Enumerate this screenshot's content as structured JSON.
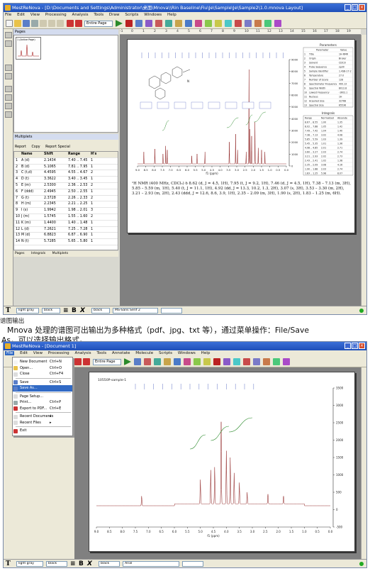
{
  "screenshot1": {
    "title": "MestReNova - [D:\\Documents and Settings\\Administrator\\桌面\\Mnova\\\\Rin Baseline\\Fiu\\Je\\Sample\\Je\\Sample2\\1.0.mnova Layout]",
    "menu": [
      "File",
      "Edit",
      "View",
      "Processing",
      "Analysis",
      "Tools",
      "Draw",
      "Scripts",
      "Windows",
      "Help"
    ],
    "toolbar_combo": "Entire Page",
    "ruler": [
      "-1",
      "0",
      "1",
      "2",
      "3",
      "4",
      "5",
      "6",
      "7",
      "8",
      "9",
      "10",
      "11",
      "12",
      "13",
      "14",
      "15",
      "16",
      "17",
      "18",
      "19",
      "20",
      "21",
      "22",
      "23",
      "24",
      "25",
      "26",
      "27"
    ],
    "pages_header": "Pages",
    "thumb_label": "1 (Active Page)",
    "table_header": "Multiplets",
    "table_tools": [
      "Report",
      "Copy",
      "Report Special"
    ],
    "table_columns": [
      "",
      "Name",
      "Shift",
      "Range",
      "H's"
    ],
    "table_rows": [
      [
        "1",
        "A (d)",
        "2.1434",
        "7.40 .. 7.45",
        "1"
      ],
      [
        "2",
        "B (d)",
        "5.1065",
        "7.81 .. 7.95",
        "1"
      ],
      [
        "3",
        "C (t,d)",
        "4.4595",
        "4.55 .. 4.67",
        "2"
      ],
      [
        "4",
        "D (t)",
        "3.3622",
        "3.40 .. 3.45",
        "1"
      ],
      [
        "5",
        "E (m)",
        "2.5300",
        "2.36 .. 2.53",
        "2"
      ],
      [
        "6",
        "F (ddd)",
        "2.4945",
        "2.50 .. 2.55",
        "1"
      ],
      [
        "7",
        "G (t)",
        "2.3728",
        "2.26 .. 2.33",
        "2"
      ],
      [
        "8",
        "H (m)",
        "2.2345",
        "2.21 .. 2.25",
        "1"
      ],
      [
        "9",
        "I (s)",
        "1.9942",
        "1.98 .. 2.01",
        "3"
      ],
      [
        "10",
        "J (m)",
        "1.5745",
        "1.55 .. 1.60",
        "2"
      ],
      [
        "11",
        "K (m)",
        "1.4400",
        "1.40 .. 1.48",
        "1"
      ],
      [
        "12",
        "L (d)",
        "7.2621",
        "7.25 .. 7.28",
        "1"
      ],
      [
        "13",
        "M (d)",
        "6.8823",
        "6.87 .. 6.90",
        "1"
      ],
      [
        "14",
        "N (t)",
        "5.7285",
        "5.65 .. 5.80",
        "1"
      ]
    ],
    "bottom_tabs": [
      "Pages",
      "Integrals",
      "Multiplets"
    ],
    "status_box1": "light gray",
    "status_box2": "black",
    "status_box3": "black",
    "status_box4": "MS-Sans Serif 2",
    "status_box5": "",
    "caption": "¹H NMR (400 MHz, CDCl₃) δ 8.62 (d, J = 4.5, 1H), 7.95 (t, J = 9.2, 1H), 7.46 (d, J = 4.5, 1H), 7.38 – 7.13 (m, 3H), 5.85 – 5.59 (m, 1H), 5.40 (t, J = 11.1, 1H), 4.92 (dd, J = 13.3, 10.2, 1.3, 2H), 3.07 (s, 3H), 3.53 – 3.30 (m, 2H), 3.21 – 2.93 (m, 2H), 2.43 (ddd, J = 12.6, 8.6, 3.9, 1H), 2.35 – 2.09 (m, 3H), 1.90 (s, 2H), 1.83 – 1.25 (m, 6H).",
    "param_title": "Parameters",
    "param_head": [
      "Parameter",
      "Value"
    ],
    "param_rows": [
      [
        "1",
        "Title",
        "1H-NMR"
      ],
      [
        "2",
        "Origin",
        "Bruker"
      ],
      [
        "3",
        "Solvent",
        "CDCl3"
      ],
      [
        "4",
        "Pulse Sequence",
        "zg30"
      ],
      [
        "5",
        "Sample Identifier",
        "1.4SB-17-2"
      ],
      [
        "6",
        "Temperature",
        "27.0"
      ],
      [
        "7",
        "Number of Scans",
        "128"
      ],
      [
        "8",
        "Spectrometer Frequency",
        "400.13"
      ],
      [
        "9",
        "Spectral Width",
        "8012.8"
      ],
      [
        "10",
        "Lowest Frequency",
        "-1602.1"
      ],
      [
        "11",
        "Nucleus",
        "1H"
      ],
      [
        "12",
        "Acquired Size",
        "32768"
      ],
      [
        "13",
        "Spectral Size",
        "65536"
      ]
    ],
    "integrals_title": "Integrals",
    "integrals_head": [
      "Range",
      "Normalized",
      "Absolute"
    ],
    "integrals_rows": [
      [
        "8.67 .. 8.55",
        "1.00",
        "1.35"
      ],
      [
        "8.02 .. 7.88",
        "1.05",
        "1.42"
      ],
      [
        "7.49 .. 7.42",
        "1.04",
        "1.40"
      ],
      [
        "7.38 .. 7.13",
        "3.02",
        "4.08"
      ],
      [
        "5.85 .. 5.59",
        "1.03",
        "1.39"
      ],
      [
        "5.45 .. 5.35",
        "1.01",
        "1.36"
      ],
      [
        "4.98 .. 4.85",
        "2.01",
        "2.71"
      ],
      [
        "3.60 .. 3.27",
        "2.03",
        "2.74"
      ],
      [
        "3.21 .. 2.93",
        "2.02",
        "2.73"
      ],
      [
        "2.43 .. 2.41",
        "1.02",
        "1.38"
      ],
      [
        "2.35 .. 2.09",
        "3.08",
        "4.16"
      ],
      [
        "1.90 .. 1.88",
        "2.03",
        "2.74"
      ],
      [
        "1.83 .. 1.25",
        "5.98",
        "8.07"
      ]
    ],
    "x_ticks": [
      "9.0",
      "8.5",
      "8.0",
      "7.5",
      "7.0",
      "6.5",
      "6.0",
      "5.5",
      "5.0",
      "4.5",
      "4.0",
      "3.5",
      "3.0",
      "2.5",
      "2.0",
      "1.5",
      "1.0",
      "0.5",
      "0.0"
    ],
    "y_ticks": [
      "9000",
      "8000",
      "7000",
      "6000",
      "5000",
      "4000",
      "3000",
      "2000",
      "1000",
      "0"
    ],
    "x_unit": "f1 (ppm)",
    "structure_label": "N"
  },
  "heading": "谱图输出",
  "body_line1": "Mnova 处理的谱图可出输出为多种格式（pdf、jpg、txt 等），通过菜单操作：File/Save",
  "body_line2": "As，可以选择输出格式。",
  "screenshot2": {
    "title": "MestReNova - [Document 1]",
    "menu": [
      "File",
      "Edit",
      "View",
      "Processing",
      "Analysis",
      "Tools",
      "Annotate",
      "Molecule",
      "Scripts",
      "Windows",
      "Help"
    ],
    "toolbar_combo": "Entire Page",
    "file_menu": [
      {
        "label": "New Document",
        "shortcut": "Ctrl+N"
      },
      {
        "label": "Open...",
        "shortcut": "Ctrl+O"
      },
      {
        "label": "Close",
        "shortcut": "Ctrl+F4"
      },
      {
        "label": "Save",
        "shortcut": "Ctrl+S"
      },
      {
        "label": "Save As...",
        "shortcut": ""
      },
      {
        "label": "Page Setup...",
        "shortcut": ""
      },
      {
        "label": "Print...",
        "shortcut": "Ctrl+P"
      },
      {
        "label": "Export to PDF...",
        "shortcut": "Ctrl+E"
      },
      {
        "label": "Recent Documents",
        "shortcut": "▸"
      },
      {
        "label": "Recent Files",
        "shortcut": "▸"
      },
      {
        "label": "Exit",
        "shortcut": ""
      }
    ],
    "doc_label": "10550P-sample-1",
    "x_ticks": [
      "9.0",
      "8.5",
      "8.0",
      "7.5",
      "7.0",
      "6.5",
      "6.0",
      "5.5",
      "5.0",
      "4.5",
      "4.0",
      "3.5",
      "3.0",
      "2.5",
      "2.0",
      "1.5",
      "1.0",
      "0.5",
      "0.0"
    ],
    "y_ticks": [
      "3500",
      "3000",
      "2500",
      "2000",
      "1500",
      "1000",
      "500",
      "0",
      "-500"
    ],
    "x_unit": "f1 (ppm)",
    "status_box1": "light gray",
    "status_box2": "black",
    "status_box3": "black",
    "status_box4": "Arial",
    "status_box5": ""
  }
}
